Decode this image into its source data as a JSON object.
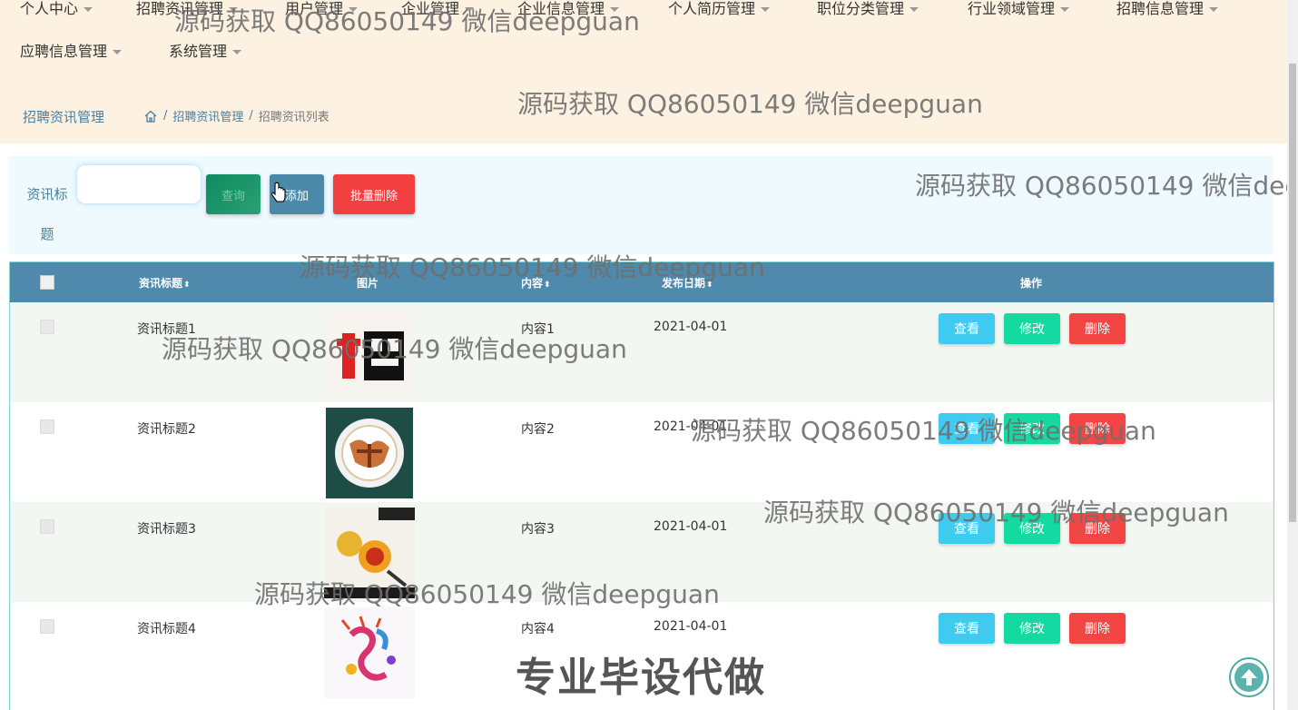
{
  "nav": {
    "row1": [
      "个人中心",
      "招聘资讯管理",
      "用户管理",
      "企业管理",
      "企业信息管理",
      "个人简历管理",
      "职位分类管理",
      "行业领域管理",
      "招聘信息管理"
    ],
    "row2": [
      "应聘信息管理",
      "系统管理"
    ]
  },
  "breadcrumb": {
    "title": "招聘资讯管理",
    "home_icon": "home-icon",
    "level1": "招聘资讯管理",
    "level2": "招聘资讯列表",
    "separator": "/"
  },
  "search": {
    "label": "资讯标题",
    "value": "",
    "query_label": "查询",
    "add_label": "添加",
    "batch_delete_label": "批量删除"
  },
  "table": {
    "headers": {
      "title": "资讯标题",
      "image": "图片",
      "content": "内容",
      "date": "发布日期",
      "actions": "操作"
    },
    "rows": [
      {
        "title": "资讯标题1",
        "content": "内容1",
        "date": "2021-04-01"
      },
      {
        "title": "资讯标题2",
        "content": "内容2",
        "date": "2021-04-01"
      },
      {
        "title": "资讯标题3",
        "content": "内容3",
        "date": "2021-04-01"
      },
      {
        "title": "资讯标题4",
        "content": "内容4",
        "date": "2021-04-01"
      }
    ],
    "action_labels": {
      "view": "查看",
      "edit": "修改",
      "delete": "删除"
    }
  },
  "watermark": {
    "text": "源码获取 QQ86050149 微信deepguan",
    "banner": "专业毕设代做"
  },
  "colors": {
    "nav_bg": "#fdf2e1",
    "header_bg": "#4f8aad",
    "view": "#3fcbf0",
    "edit": "#14d9a0",
    "delete": "#f44545"
  }
}
